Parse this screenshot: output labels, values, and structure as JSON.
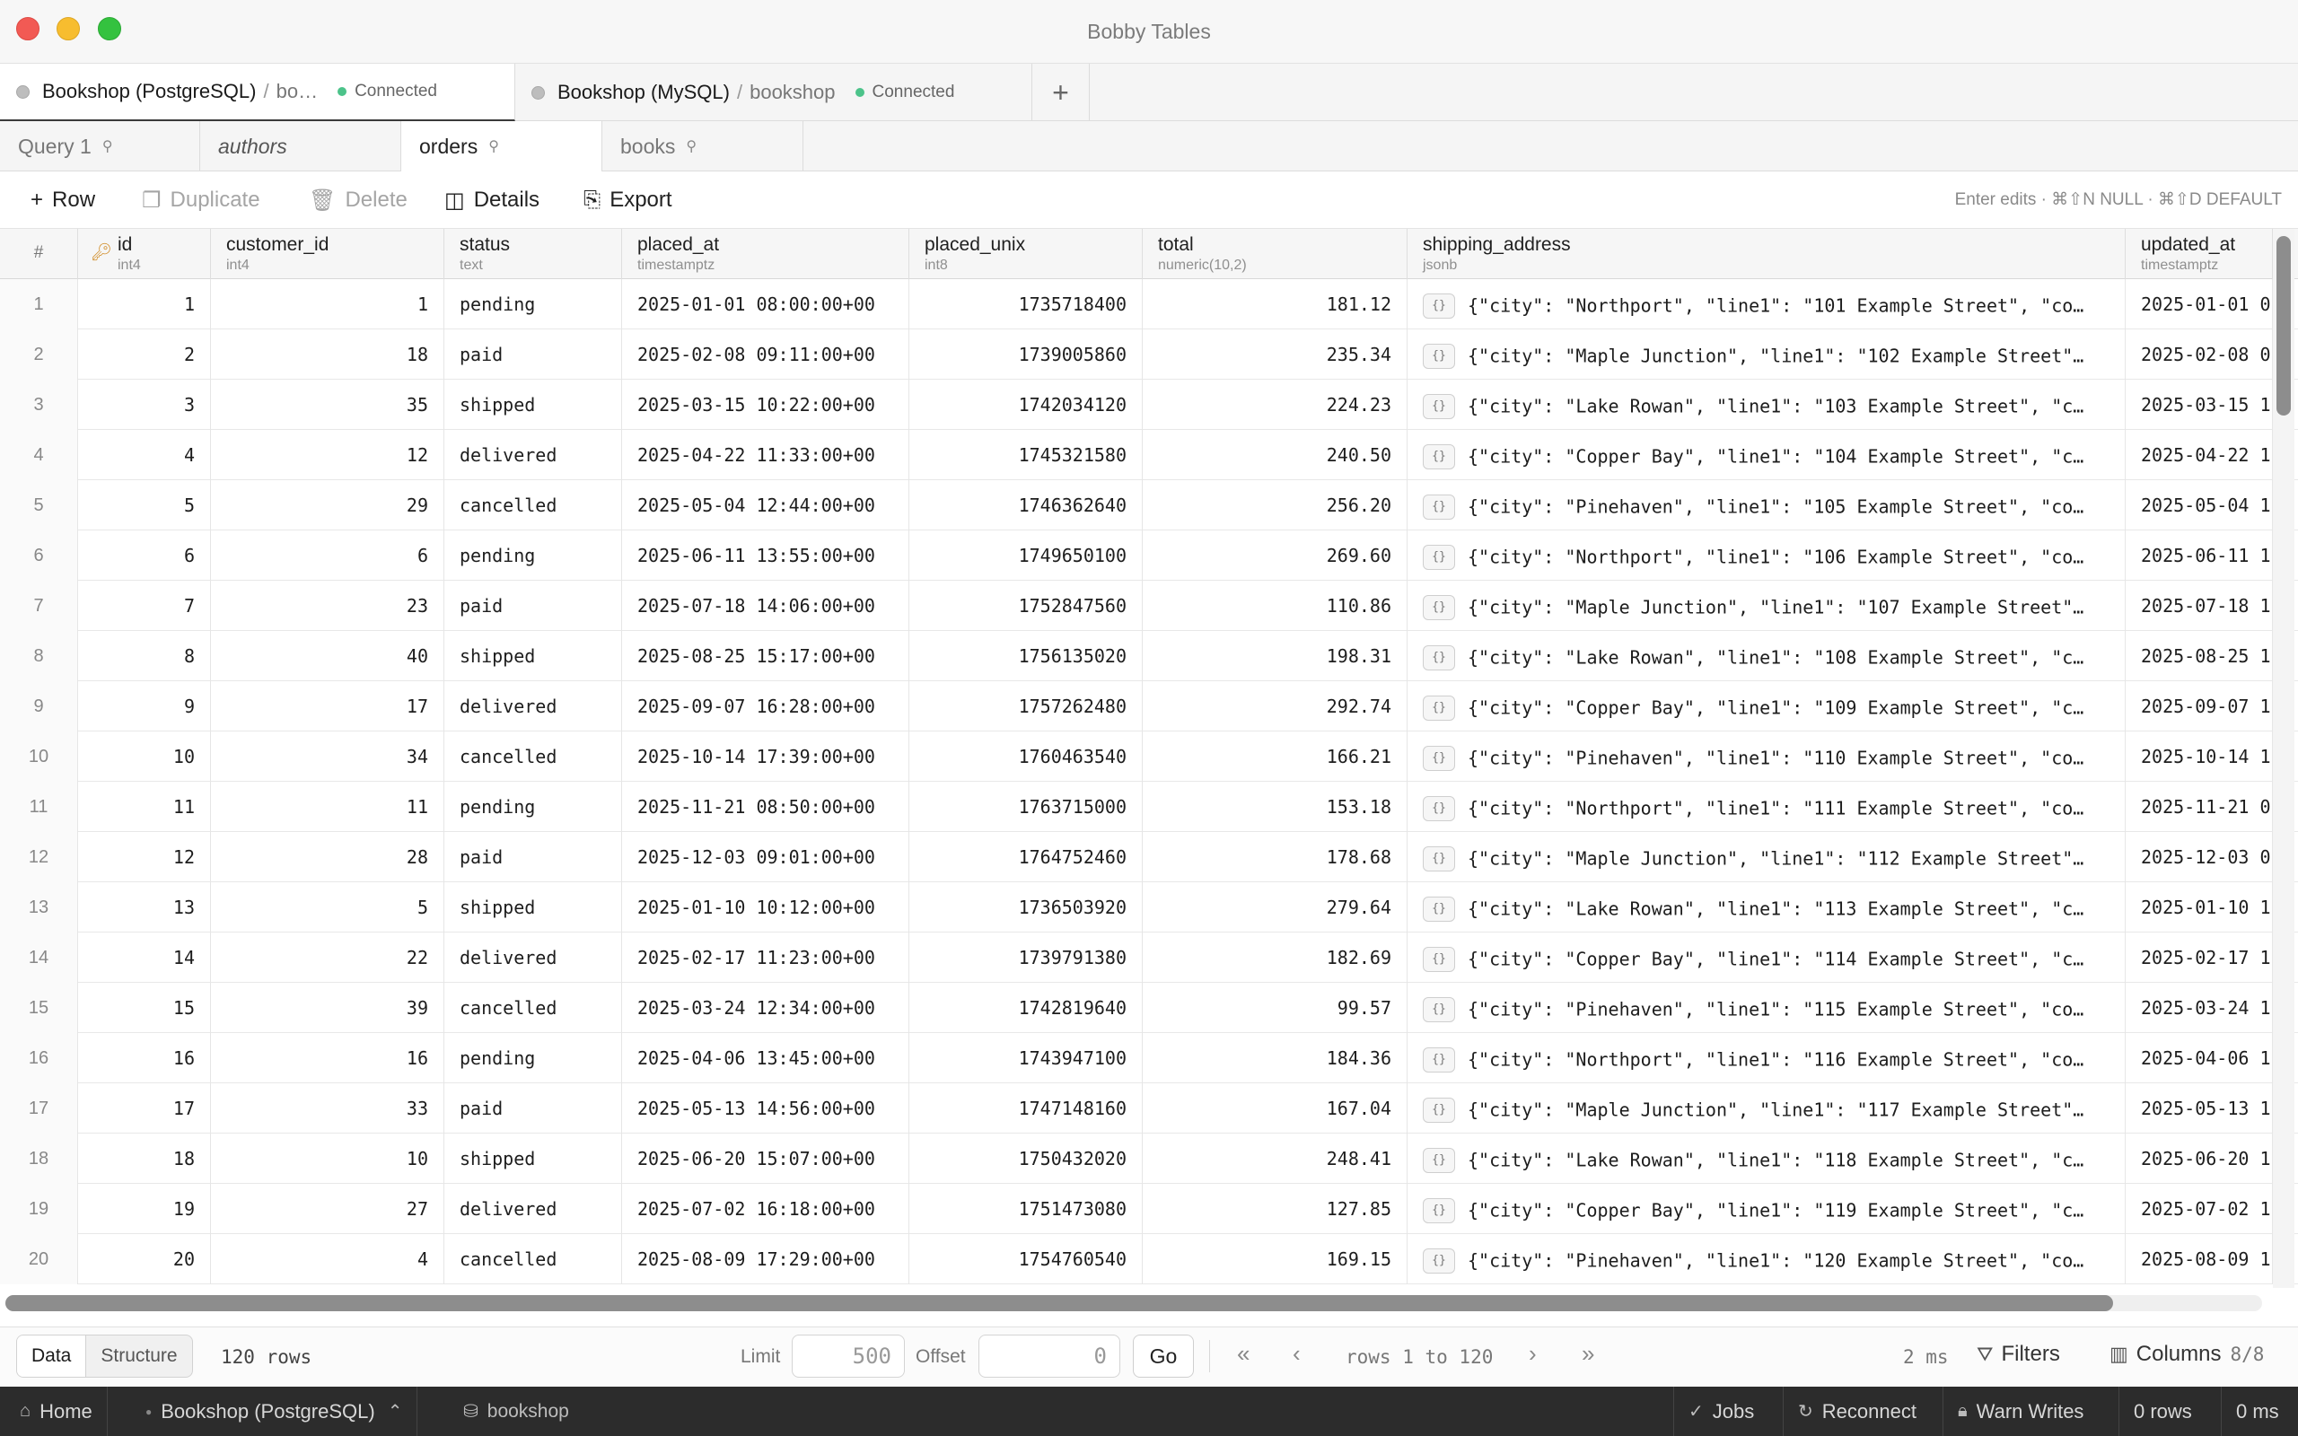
{
  "window": {
    "title": "Bobby Tables"
  },
  "connection_tabs": [
    {
      "name": "Bookshop (PostgreSQL)",
      "db": "bo…",
      "status": "Connected"
    },
    {
      "name": "Bookshop (MySQL)",
      "db": "bookshop",
      "status": "Connected"
    }
  ],
  "query_tabs": [
    {
      "label": "Query 1"
    },
    {
      "label": "authors"
    },
    {
      "label": "orders"
    },
    {
      "label": "books"
    }
  ],
  "toolbar": {
    "row": "Row",
    "duplicate": "Duplicate",
    "delete": "Delete",
    "details": "Details",
    "export": "Export",
    "hint": "Enter edits · ⌘⇧N NULL · ⌘⇧D DEFAULT"
  },
  "columns": [
    {
      "name": "id",
      "type": "int4"
    },
    {
      "name": "customer_id",
      "type": "int4"
    },
    {
      "name": "status",
      "type": "text"
    },
    {
      "name": "placed_at",
      "type": "timestamptz"
    },
    {
      "name": "placed_unix",
      "type": "int8"
    },
    {
      "name": "total",
      "type": "numeric(10,2)"
    },
    {
      "name": "shipping_address",
      "type": "jsonb"
    },
    {
      "name": "updated_at",
      "type": "timestamptz"
    }
  ],
  "row_number_header": "#",
  "rows": [
    [
      "1",
      "1",
      "1",
      "pending",
      "2025-01-01 08:00:00+00",
      "1735718400",
      "181.12",
      "{\"city\": \"Northport\", \"line1\": \"101 Example Street\", \"co…",
      "2025-01-01 0"
    ],
    [
      "2",
      "2",
      "18",
      "paid",
      "2025-02-08 09:11:00+00",
      "1739005860",
      "235.34",
      "{\"city\": \"Maple Junction\", \"line1\": \"102 Example Street\"…",
      "2025-02-08 0"
    ],
    [
      "3",
      "3",
      "35",
      "shipped",
      "2025-03-15 10:22:00+00",
      "1742034120",
      "224.23",
      "{\"city\": \"Lake Rowan\", \"line1\": \"103 Example Street\", \"c…",
      "2025-03-15 1"
    ],
    [
      "4",
      "4",
      "12",
      "delivered",
      "2025-04-22 11:33:00+00",
      "1745321580",
      "240.50",
      "{\"city\": \"Copper Bay\", \"line1\": \"104 Example Street\", \"c…",
      "2025-04-22 1"
    ],
    [
      "5",
      "5",
      "29",
      "cancelled",
      "2025-05-04 12:44:00+00",
      "1746362640",
      "256.20",
      "{\"city\": \"Pinehaven\", \"line1\": \"105 Example Street\", \"co…",
      "2025-05-04 1"
    ],
    [
      "6",
      "6",
      "6",
      "pending",
      "2025-06-11 13:55:00+00",
      "1749650100",
      "269.60",
      "{\"city\": \"Northport\", \"line1\": \"106 Example Street\", \"co…",
      "2025-06-11 1"
    ],
    [
      "7",
      "7",
      "23",
      "paid",
      "2025-07-18 14:06:00+00",
      "1752847560",
      "110.86",
      "{\"city\": \"Maple Junction\", \"line1\": \"107 Example Street\"…",
      "2025-07-18 1"
    ],
    [
      "8",
      "8",
      "40",
      "shipped",
      "2025-08-25 15:17:00+00",
      "1756135020",
      "198.31",
      "{\"city\": \"Lake Rowan\", \"line1\": \"108 Example Street\", \"c…",
      "2025-08-25 1"
    ],
    [
      "9",
      "9",
      "17",
      "delivered",
      "2025-09-07 16:28:00+00",
      "1757262480",
      "292.74",
      "{\"city\": \"Copper Bay\", \"line1\": \"109 Example Street\", \"c…",
      "2025-09-07 1"
    ],
    [
      "10",
      "10",
      "34",
      "cancelled",
      "2025-10-14 17:39:00+00",
      "1760463540",
      "166.21",
      "{\"city\": \"Pinehaven\", \"line1\": \"110 Example Street\", \"co…",
      "2025-10-14 1"
    ],
    [
      "11",
      "11",
      "11",
      "pending",
      "2025-11-21 08:50:00+00",
      "1763715000",
      "153.18",
      "{\"city\": \"Northport\", \"line1\": \"111 Example Street\", \"co…",
      "2025-11-21 0"
    ],
    [
      "12",
      "12",
      "28",
      "paid",
      "2025-12-03 09:01:00+00",
      "1764752460",
      "178.68",
      "{\"city\": \"Maple Junction\", \"line1\": \"112 Example Street\"…",
      "2025-12-03 0"
    ],
    [
      "13",
      "13",
      "5",
      "shipped",
      "2025-01-10 10:12:00+00",
      "1736503920",
      "279.64",
      "{\"city\": \"Lake Rowan\", \"line1\": \"113 Example Street\", \"c…",
      "2025-01-10 1"
    ],
    [
      "14",
      "14",
      "22",
      "delivered",
      "2025-02-17 11:23:00+00",
      "1739791380",
      "182.69",
      "{\"city\": \"Copper Bay\", \"line1\": \"114 Example Street\", \"c…",
      "2025-02-17 1"
    ],
    [
      "15",
      "15",
      "39",
      "cancelled",
      "2025-03-24 12:34:00+00",
      "1742819640",
      "99.57",
      "{\"city\": \"Pinehaven\", \"line1\": \"115 Example Street\", \"co…",
      "2025-03-24 1"
    ],
    [
      "16",
      "16",
      "16",
      "pending",
      "2025-04-06 13:45:00+00",
      "1743947100",
      "184.36",
      "{\"city\": \"Northport\", \"line1\": \"116 Example Street\", \"co…",
      "2025-04-06 1"
    ],
    [
      "17",
      "17",
      "33",
      "paid",
      "2025-05-13 14:56:00+00",
      "1747148160",
      "167.04",
      "{\"city\": \"Maple Junction\", \"line1\": \"117 Example Street\"…",
      "2025-05-13 1"
    ],
    [
      "18",
      "18",
      "10",
      "shipped",
      "2025-06-20 15:07:00+00",
      "1750432020",
      "248.41",
      "{\"city\": \"Lake Rowan\", \"line1\": \"118 Example Street\", \"c…",
      "2025-06-20 1"
    ],
    [
      "19",
      "19",
      "27",
      "delivered",
      "2025-07-02 16:18:00+00",
      "1751473080",
      "127.85",
      "{\"city\": \"Copper Bay\", \"line1\": \"119 Example Street\", \"c…",
      "2025-07-02 1"
    ],
    [
      "20",
      "20",
      "4",
      "cancelled",
      "2025-08-09 17:29:00+00",
      "1754760540",
      "169.15",
      "{\"city\": \"Pinehaven\", \"line1\": \"120 Example Street\", \"co…",
      "2025-08-09 1"
    ]
  ],
  "json_badge": "{}",
  "footer": {
    "data_tab": "Data",
    "structure_tab": "Structure",
    "row_count": "120 rows",
    "limit_label": "Limit",
    "limit_value": "500",
    "offset_label": "Offset",
    "offset_value": "0",
    "go": "Go",
    "range": "rows 1 to 120",
    "timing": "2 ms",
    "filters": "Filters",
    "columns": "Columns",
    "columns_count": "8/8"
  },
  "statusbar": {
    "home": "Home",
    "connection": "Bookshop (PostgreSQL)",
    "database": "bookshop",
    "jobs": "Jobs",
    "reconnect": "Reconnect",
    "warn_writes": "Warn Writes",
    "rows": "0 rows",
    "time": "0 ms"
  }
}
